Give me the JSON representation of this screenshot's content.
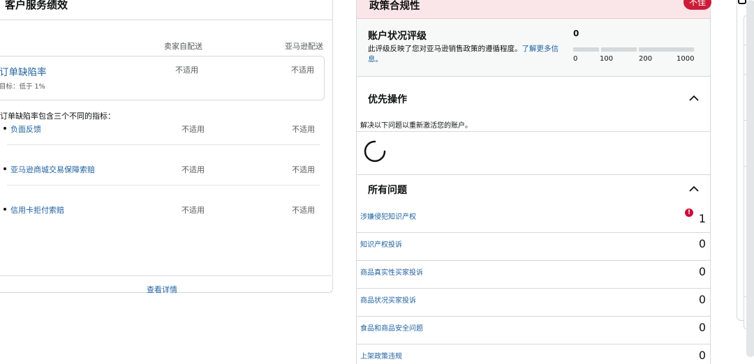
{
  "customer_service": {
    "title": "客户服务绩效",
    "col_seller": "卖家自配送",
    "col_amazon": "亚马逊配送",
    "odr": {
      "title": "订单缺陷率",
      "target": "目标：低于 1%",
      "seller_value": "不适用",
      "amazon_value": "不适用"
    },
    "intro": "订单缺陷率包含三个不同的指标：",
    "metrics": [
      {
        "name": "负面反馈",
        "seller": "不适用",
        "amazon": "不适用"
      },
      {
        "name": "亚马逊商城交易保障索赔",
        "seller": "不适用",
        "amazon": "不适用"
      },
      {
        "name": "信用卡拒付索赔",
        "seller": "不适用",
        "amazon": "不适用"
      }
    ],
    "view_details": "查看详情"
  },
  "policy": {
    "title": "政策合规性",
    "badge": "不佳",
    "badge_color": "#cc1c39",
    "header_bg": "#fae6e9",
    "health": {
      "title": "账户状况评级",
      "desc": "此评级反映了您对亚马逊销售政策的遵循程度。",
      "link": "了解更多信息。",
      "score": "0",
      "ticks": [
        "0",
        "100",
        "200",
        "1000"
      ]
    },
    "priority": {
      "title": "优先操作",
      "desc": "解决以下问题以重新激活您的账户。"
    },
    "all_issues": {
      "title": "所有问题",
      "items": [
        {
          "label": "涉嫌侵犯知识产权",
          "count": "1",
          "warning": true
        },
        {
          "label": "知识产权投诉",
          "count": "0"
        },
        {
          "label": "商品真实性买家投诉",
          "count": "0"
        },
        {
          "label": "商品状况买家投诉",
          "count": "0"
        },
        {
          "label": "食品和商品安全问题",
          "count": "0"
        },
        {
          "label": "上架政策违规",
          "count": "0"
        }
      ]
    }
  },
  "colors": {
    "link": "#2162a1",
    "border": "#d5d9d9",
    "warning": "#cc0c39"
  }
}
